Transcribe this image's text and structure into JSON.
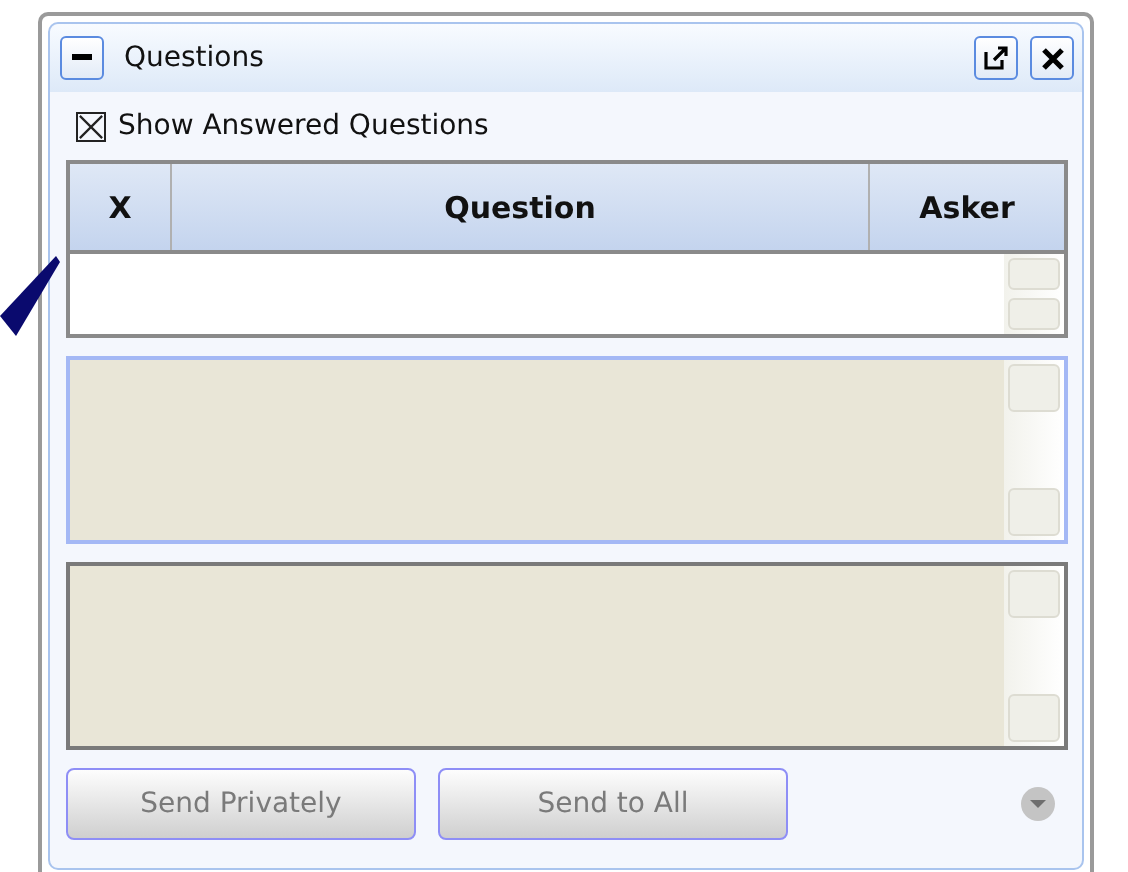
{
  "window": {
    "title": "Questions"
  },
  "show_answered": {
    "label": "Show Answered Questions",
    "checked": true
  },
  "table": {
    "columns": [
      "X",
      "Question",
      "Asker"
    ]
  },
  "buttons": [
    {
      "label": "Send Privately",
      "disabled": true
    },
    {
      "label": "Send to All",
      "disabled": true
    }
  ]
}
